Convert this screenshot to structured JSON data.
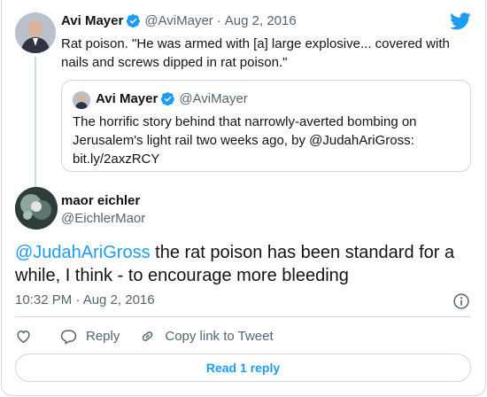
{
  "parent_tweet": {
    "author_name": "Avi Mayer",
    "author_handle": "@AviMayer",
    "separator": "·",
    "date": "Aug 2, 2016",
    "text": "Rat poison. \"He was armed with [a] large explosive... covered with nails and screws dipped in rat poison.\"",
    "quoted_tweet": {
      "author_name": "Avi Mayer",
      "author_handle": "@AviMayer",
      "text": "The horrific story behind that narrowly-averted bombing on Jerusalem's light rail two weeks ago, by @JudahAriGross: bit.ly/2axzRCY"
    }
  },
  "main_tweet": {
    "author_name": "maor eichler",
    "author_handle": "@EichlerMaor",
    "mention": "@JudahAriGross",
    "text": " the rat poison has been standard for a while, I think - to encourage more bleeding",
    "time": "10:32 PM · Aug 2, 2016"
  },
  "actions": {
    "reply_label": "Reply",
    "copy_link_label": "Copy link to Tweet"
  },
  "read_replies_label": "Read 1 reply",
  "icons": {
    "brand": "twitter-bird-icon",
    "verified": "verified-badge-icon",
    "like": "heart-icon",
    "reply": "speech-bubble-icon",
    "copy_link": "link-icon",
    "info": "info-icon"
  },
  "colors": {
    "accent": "#1d9bf0",
    "text": "#0f1419",
    "muted": "#536471",
    "border": "#cfd9de"
  }
}
